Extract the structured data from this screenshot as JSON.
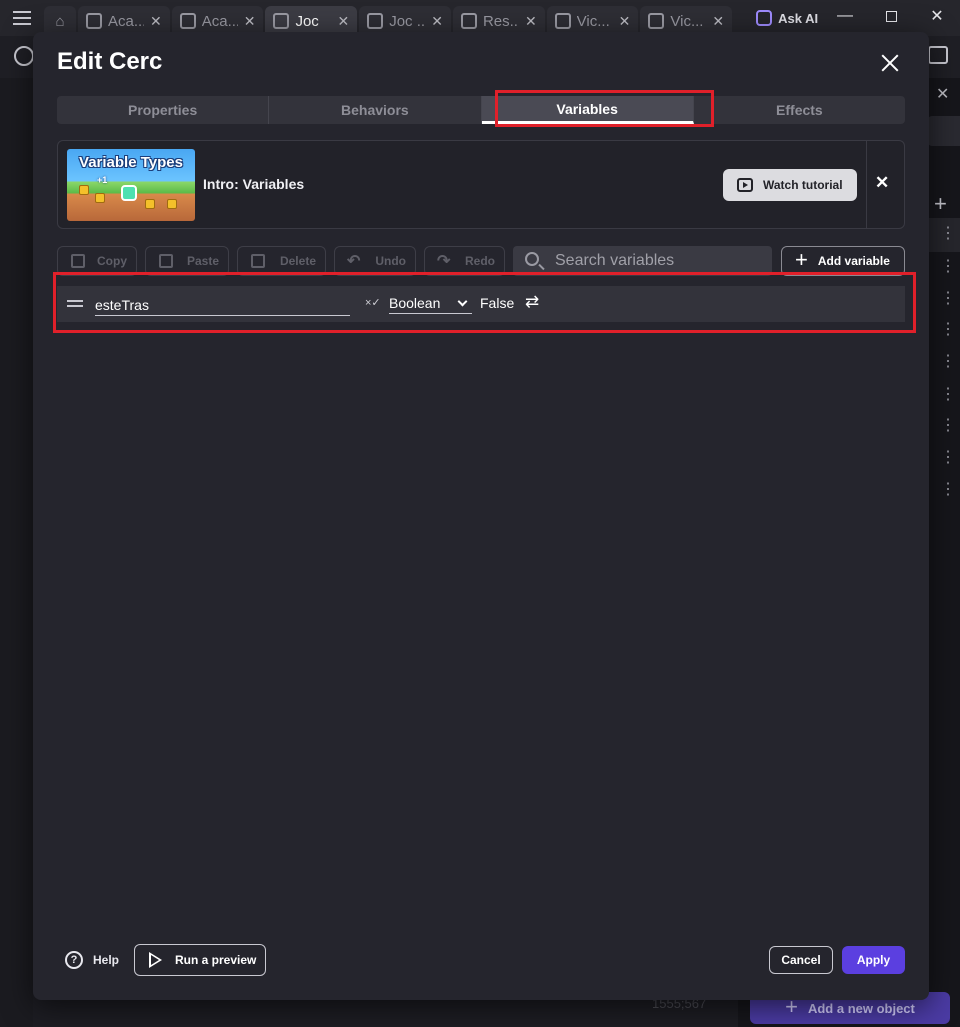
{
  "topbar": {
    "tabs": [
      {
        "label": "Aca..."
      },
      {
        "label": "Aca..."
      },
      {
        "label": "Joc"
      },
      {
        "label": "Joc ..."
      },
      {
        "label": "Res..."
      },
      {
        "label": "Vic..."
      },
      {
        "label": "Vic..."
      }
    ],
    "ask_ai": "Ask AI"
  },
  "background": {
    "add_object_label": "Add a new object",
    "coordinates": "1555;567"
  },
  "modal": {
    "title": "Edit Cerc",
    "tabs": [
      "Properties",
      "Behaviors",
      "Variables",
      "Effects"
    ],
    "active_tab": "Variables",
    "banner": {
      "thumbnail_title": "Variable Types",
      "thumbnail_badge": "+1",
      "label": "Intro: Variables",
      "watch_label": "Watch tutorial"
    },
    "toolbar": {
      "copy": "Copy",
      "paste": "Paste",
      "delete": "Delete",
      "undo": "Undo",
      "redo": "Redo",
      "search_placeholder": "Search variables",
      "add_variable": "Add variable"
    },
    "variables": [
      {
        "name": "esteTras",
        "type": "Boolean",
        "value": "False"
      }
    ],
    "footer": {
      "help": "Help",
      "run_preview": "Run a preview",
      "cancel": "Cancel",
      "apply": "Apply"
    }
  },
  "colors": {
    "accent": "#5b3fe0",
    "highlight": "#e0202a",
    "dialog_bg": "#25252d"
  }
}
